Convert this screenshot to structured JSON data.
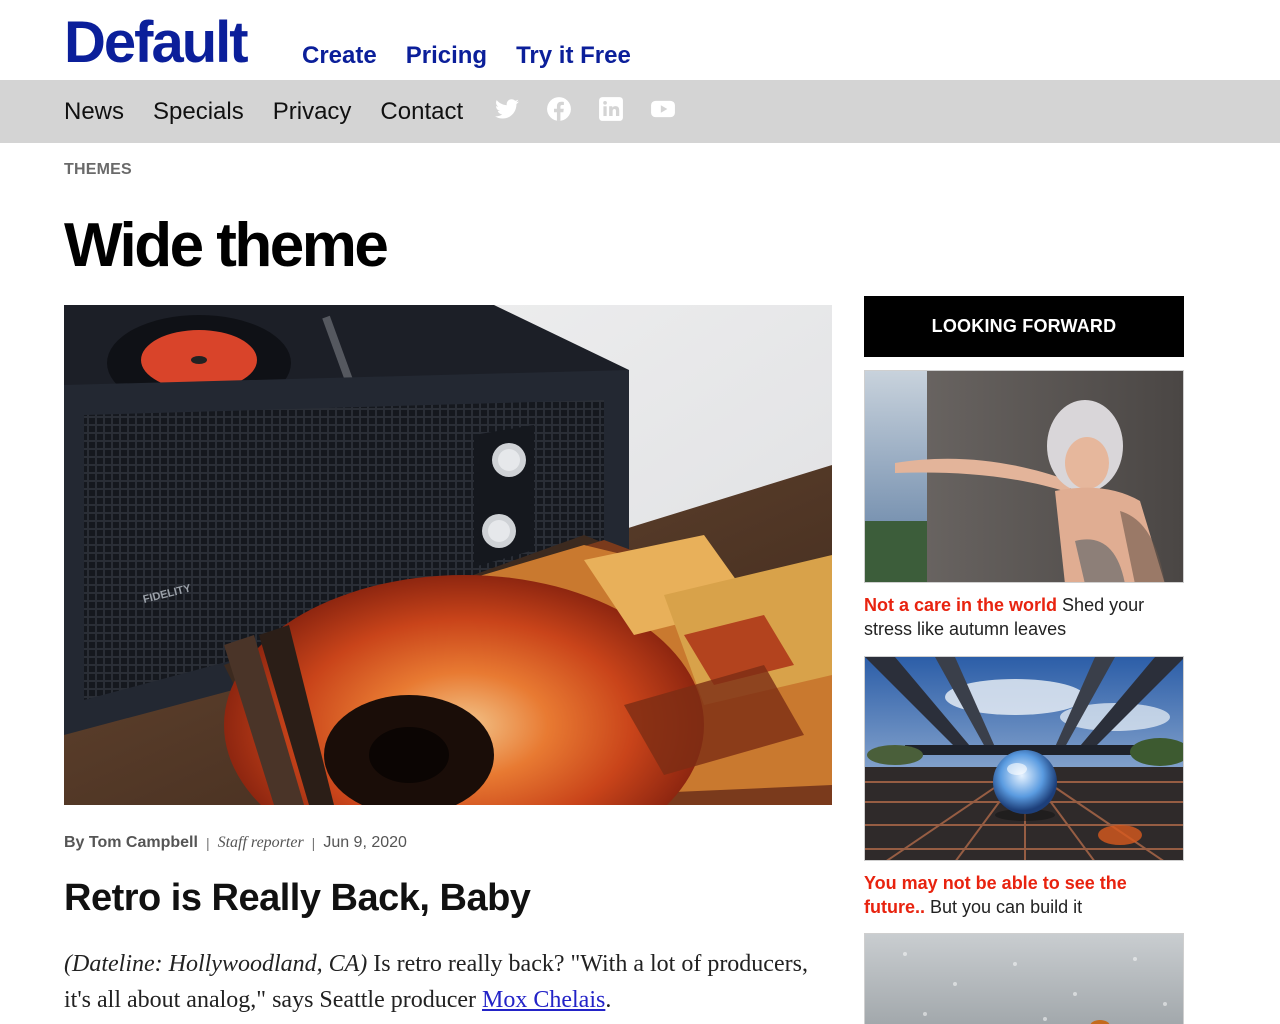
{
  "site": {
    "logo": "Default",
    "top_nav": [
      "Create",
      "Pricing",
      "Try it Free"
    ],
    "sub_nav": [
      "News",
      "Specials",
      "Privacy",
      "Contact"
    ],
    "social_icons": [
      "twitter-icon",
      "facebook-icon",
      "linkedin-icon",
      "youtube-icon"
    ]
  },
  "page": {
    "breadcrumb": "THEMES",
    "title": "Wide theme"
  },
  "article": {
    "author": "By Tom Campbell",
    "role": "Staff reporter",
    "date": "Jun 9, 2020",
    "headline": "Retro is Really Back, Baby",
    "dateline": "(Dateline: Hollywoodland, CA)",
    "body_start": " Is retro really back? \"With a lot of producers, it's all about analog,\" says Seattle producer ",
    "link_text": "Mox Chelais",
    "body_end": "."
  },
  "sidebar": {
    "header": "LOOKING FORWARD",
    "items": [
      {
        "highlight": "Not a care in the world",
        "text": " Shed your stress like autumn leaves"
      },
      {
        "highlight": "You may not be able to see the future..",
        "text": " But you can build it"
      }
    ]
  },
  "colors": {
    "brand": "#0b1f9a",
    "nav_bar": "#d4d4d4",
    "accent_red": "#e8230f",
    "link": "#2323c7"
  }
}
